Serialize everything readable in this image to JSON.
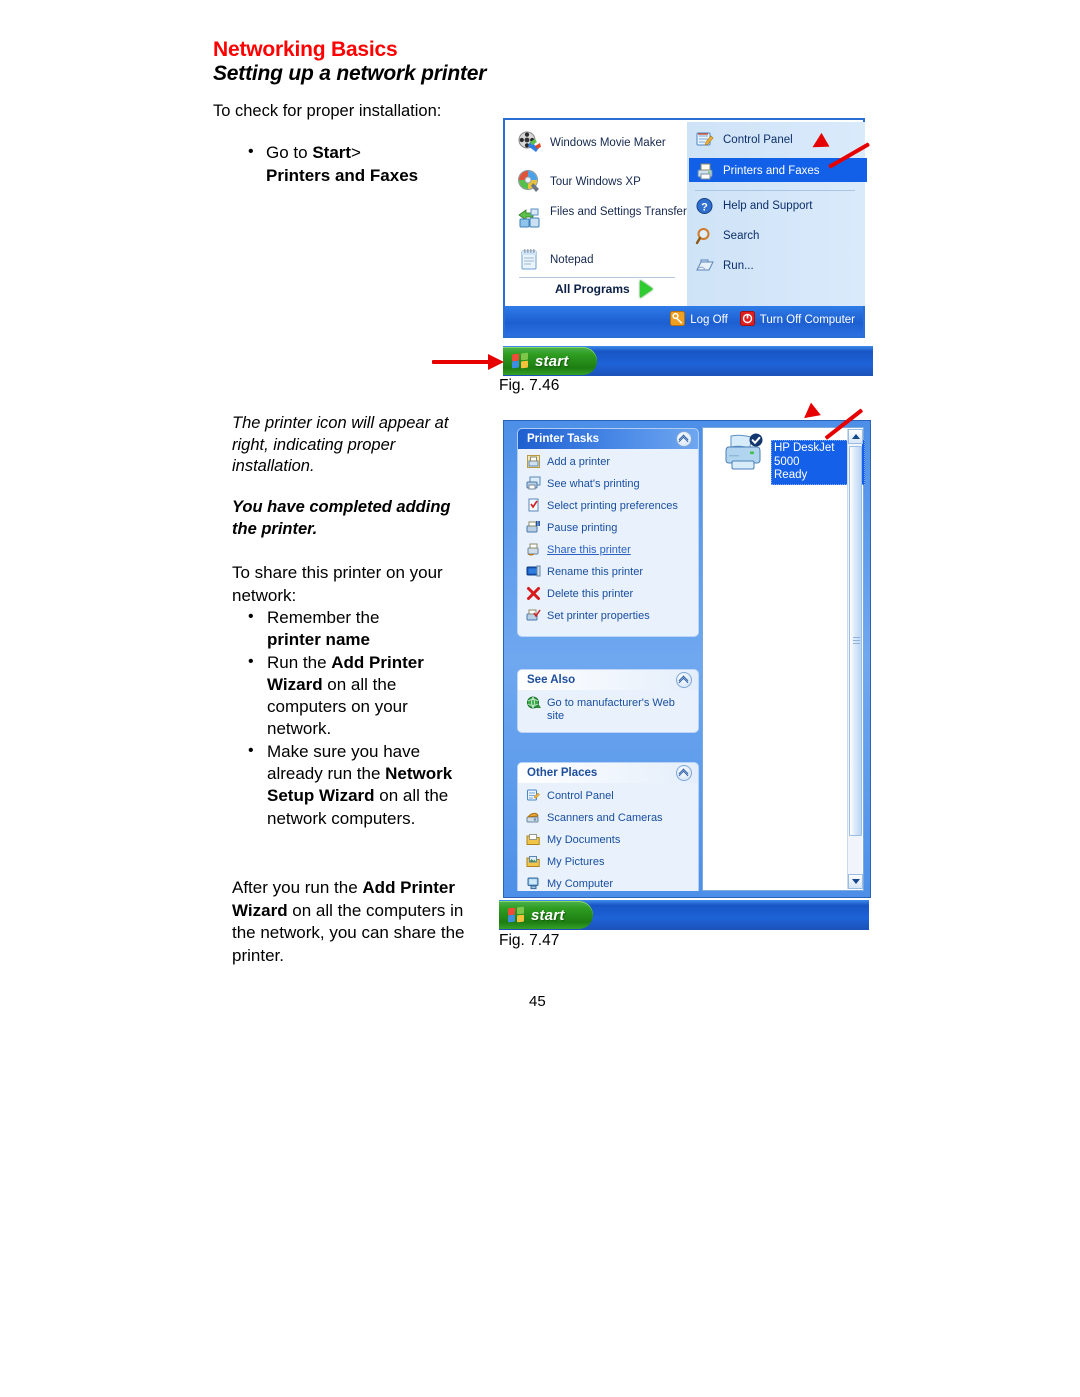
{
  "document": {
    "header_title": "Networking Basics",
    "header_subtitle": "Setting up a network printer",
    "lead": "To check for proper installation:",
    "bullet_goto_prefix": "Go to ",
    "bullet_goto_bold": "Start",
    "bullet_goto_suffix": ">",
    "bullet_printers_faxes": "Printers and Faxes",
    "italic_note_1": "The printer icon will appear at right, indicating proper installation.",
    "italic_note_2": "You have completed adding the printer.",
    "para_share": "To share this printer on your network:",
    "bullet_remember_1": "Remember the",
    "bullet_remember_2": "printer name",
    "bullet_run_pre": "Run the ",
    "bullet_run_bold": "Add Printer Wizard",
    "bullet_run_post": " on all the computers on your network.",
    "bullet_make_pre": "Make sure you have already run the ",
    "bullet_make_bold": "Network Setup Wizard",
    "bullet_make_post": " on all the network computers.",
    "para_after_pre": "After you run the ",
    "para_after_bold": "Add Printer Wizard",
    "para_after_post": " on all the computers in the network, you can share the printer.",
    "fig_746_caption": "Fig. 7.46",
    "fig_747_caption": "Fig. 7.47",
    "page_number": "45"
  },
  "start_menu": {
    "left_items": [
      {
        "label": "Windows Movie Maker",
        "icon": "movie-maker-icon"
      },
      {
        "label": "Tour Windows XP",
        "icon": "tour-windows-xp-icon"
      },
      {
        "label": "Files and Settings Transfer Wizard",
        "icon": "files-settings-transfer-icon"
      },
      {
        "label": "Notepad",
        "icon": "notepad-icon"
      }
    ],
    "all_programs": "All Programs",
    "right_items": [
      {
        "label": "Control Panel",
        "icon": "control-panel-icon",
        "selected": false
      },
      {
        "label": "Printers and Faxes",
        "icon": "printers-faxes-icon",
        "selected": true
      },
      {
        "label": "Help and Support",
        "icon": "help-support-icon",
        "selected": false
      },
      {
        "label": "Search",
        "icon": "search-icon",
        "selected": false
      },
      {
        "label": "Run...",
        "icon": "run-icon",
        "selected": false
      }
    ],
    "log_off": "Log Off",
    "turn_off": "Turn Off Computer",
    "start_button": "start"
  },
  "printers_window": {
    "start_button": "start",
    "printer_tasks": {
      "title": "Printer Tasks",
      "items": [
        {
          "label": "Add a printer",
          "icon": "add-printer-icon",
          "link": false
        },
        {
          "label": "See what's printing",
          "icon": "see-printing-icon",
          "link": false
        },
        {
          "label": "Select printing preferences",
          "icon": "printing-preferences-icon",
          "link": false
        },
        {
          "label": "Pause printing",
          "icon": "pause-printing-icon",
          "link": false
        },
        {
          "label": "Share this printer",
          "icon": "share-printer-icon",
          "link": true
        },
        {
          "label": "Rename this printer",
          "icon": "rename-printer-icon",
          "link": false
        },
        {
          "label": "Delete this printer",
          "icon": "delete-printer-icon",
          "link": false
        },
        {
          "label": "Set printer properties",
          "icon": "printer-properties-icon",
          "link": false
        }
      ]
    },
    "see_also": {
      "title": "See Also",
      "items": [
        {
          "label": "Go to manufacturer's Web site",
          "icon": "globe-icon"
        }
      ]
    },
    "other_places": {
      "title": "Other Places",
      "items": [
        {
          "label": "Control Panel",
          "icon": "control-panel-icon"
        },
        {
          "label": "Scanners and Cameras",
          "icon": "scanners-cameras-icon"
        },
        {
          "label": "My Documents",
          "icon": "my-documents-icon"
        },
        {
          "label": "My Pictures",
          "icon": "my-pictures-icon"
        },
        {
          "label": "My Computer",
          "icon": "my-computer-icon"
        }
      ]
    },
    "printer": {
      "name": "HP DeskJet 5000",
      "status": "Ready",
      "default": true
    }
  },
  "colors": {
    "header_red": "#ff0000",
    "xp_blue": "#1e5fd0",
    "selection_blue": "#1560e8",
    "arrow_red": "#e60000",
    "start_green": "#2f9e22",
    "link_blue": "#1a4fa0"
  }
}
